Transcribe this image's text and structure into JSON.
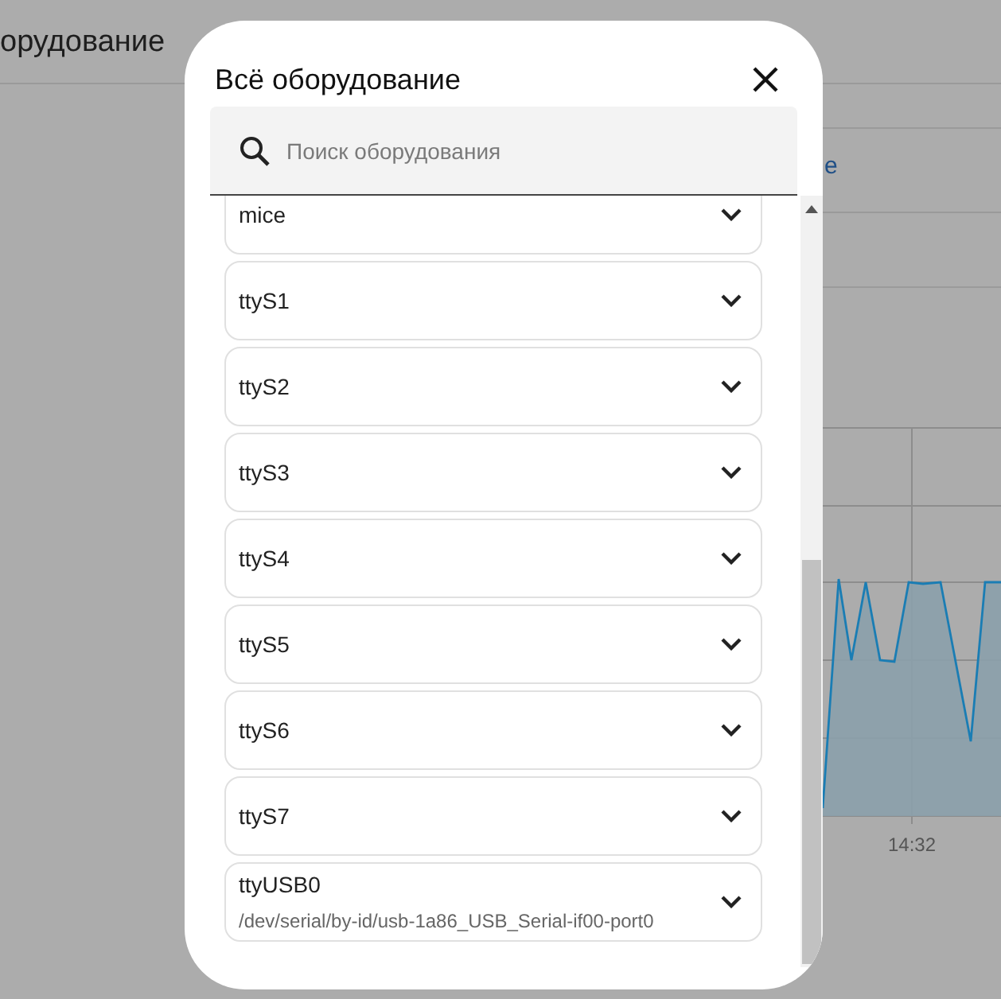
{
  "background": {
    "heading": "орудование",
    "link_fragment": "e",
    "chart_time_label": "14:32"
  },
  "dialog": {
    "title": "Всё оборудование",
    "search": {
      "placeholder": "Поиск оборудования"
    },
    "devices": [
      {
        "name": "mice",
        "expanded": false
      },
      {
        "name": "ttyS1",
        "expanded": false
      },
      {
        "name": "ttyS2",
        "expanded": false
      },
      {
        "name": "ttyS3",
        "expanded": false
      },
      {
        "name": "ttyS4",
        "expanded": false
      },
      {
        "name": "ttyS5",
        "expanded": false
      },
      {
        "name": "ttyS6",
        "expanded": false
      },
      {
        "name": "ttyS7",
        "expanded": false
      },
      {
        "name": "ttyUSB0",
        "path": "/dev/serial/by-id/usb-1a86_USB_Serial-if00-port0",
        "expanded": false
      }
    ]
  }
}
